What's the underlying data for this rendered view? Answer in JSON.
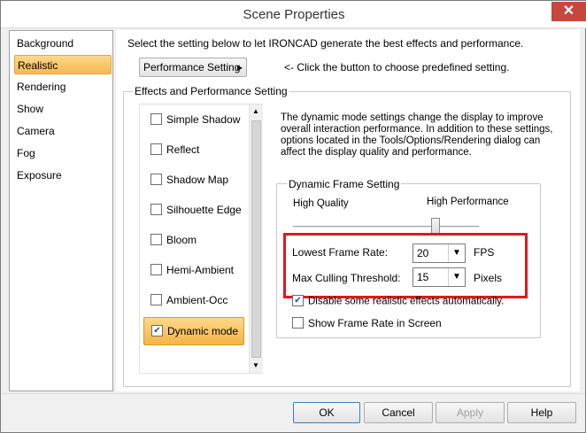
{
  "window": {
    "title": "Scene Properties",
    "close_glyph": "✕"
  },
  "nav": {
    "items": [
      {
        "label": "Background",
        "selected": false
      },
      {
        "label": "Realistic",
        "selected": true
      },
      {
        "label": "Rendering",
        "selected": false
      },
      {
        "label": "Show",
        "selected": false
      },
      {
        "label": "Camera",
        "selected": false
      },
      {
        "label": "Fog",
        "selected": false
      },
      {
        "label": "Exposure",
        "selected": false
      }
    ]
  },
  "header": {
    "instruction": "Select the setting below to let IRONCAD generate the best effects and performance.",
    "perf_button": "Performance Setting",
    "perf_arrow": "▸",
    "perf_hint": "<- Click the button to choose predefined setting."
  },
  "effects": {
    "group_label": "Effects and Performance Setting",
    "options": [
      {
        "label": "Simple Shadow",
        "checked": false
      },
      {
        "label": "Reflect",
        "checked": false
      },
      {
        "label": "Shadow Map",
        "checked": false
      },
      {
        "label": "Silhouette Edge",
        "checked": false
      },
      {
        "label": "Bloom",
        "checked": false
      },
      {
        "label": "Hemi-Ambient",
        "checked": false
      },
      {
        "label": "Ambient-Occ",
        "checked": false
      },
      {
        "label": "Dynamic mode",
        "checked": true
      }
    ],
    "description": "The dynamic mode settings change the display to improve overall interaction performance. In addition to these settings, options located in the Tools/Options/Rendering dialog can affect the display quality and performance."
  },
  "dynamic": {
    "group_label": "Dynamic Frame Setting",
    "slider_left": "High Quality",
    "slider_right": "High Performance",
    "lowest_frame_label": "Lowest Frame Rate:",
    "lowest_frame_value": "20",
    "lowest_frame_unit": "FPS",
    "culling_label": "Max Culling Threshold:",
    "culling_value": "15",
    "culling_unit": "Pixels",
    "disable_label": "Disable some realistic effects automatically.",
    "disable_checked": true,
    "show_rate_label": "Show Frame Rate in Screen",
    "show_rate_checked": false
  },
  "footer": {
    "ok": "OK",
    "cancel": "Cancel",
    "apply": "Apply",
    "help": "Help"
  },
  "colors": {
    "highlight": "#e3171e",
    "selection": "#f5b94d"
  }
}
